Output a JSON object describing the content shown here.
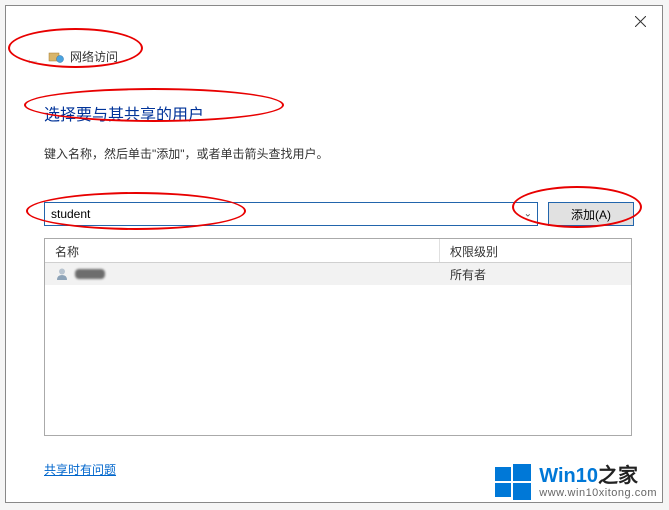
{
  "breadcrumb": {
    "label": "网络访问"
  },
  "heading": "选择要与其共享的用户",
  "subheading": "键入名称，然后单击\"添加\"，或者单击箭头查找用户。",
  "input": {
    "value": "student",
    "add_label": "添加(A)"
  },
  "table": {
    "headers": {
      "name": "名称",
      "permission": "权限级别"
    },
    "rows": [
      {
        "name": "",
        "permission": "所有者"
      }
    ]
  },
  "help_link": "共享时有问题",
  "watermark": {
    "brand_a": "Win10",
    "brand_b": "之家",
    "url": "www.win10xitong.com"
  }
}
